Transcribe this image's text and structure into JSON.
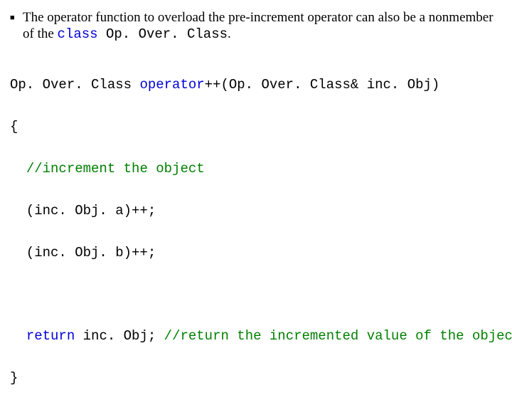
{
  "bullet": {
    "glyph": "■",
    "text_before": "The operator function to overload the pre-increment operator can also be a nonmember of the ",
    "class_kw": "class",
    "class_name": " Op. Over. Class",
    "period": "."
  },
  "code": {
    "l1_a": "Op. Over. Class ",
    "l1_b": "operator",
    "l1_c": "++(Op. Over. Class& inc. Obj)",
    "l2": "{",
    "l3_a": "  ",
    "l3_b": "//increment the object",
    "l4": "  (inc. Obj. a)++;",
    "l5": "  (inc. Obj. b)++;",
    "blank": " ",
    "l6_a": "  ",
    "l6_b": "return ",
    "l6_c": "inc. Obj; ",
    "l6_d": "//return the incremented value of the object",
    "l7": "}"
  }
}
